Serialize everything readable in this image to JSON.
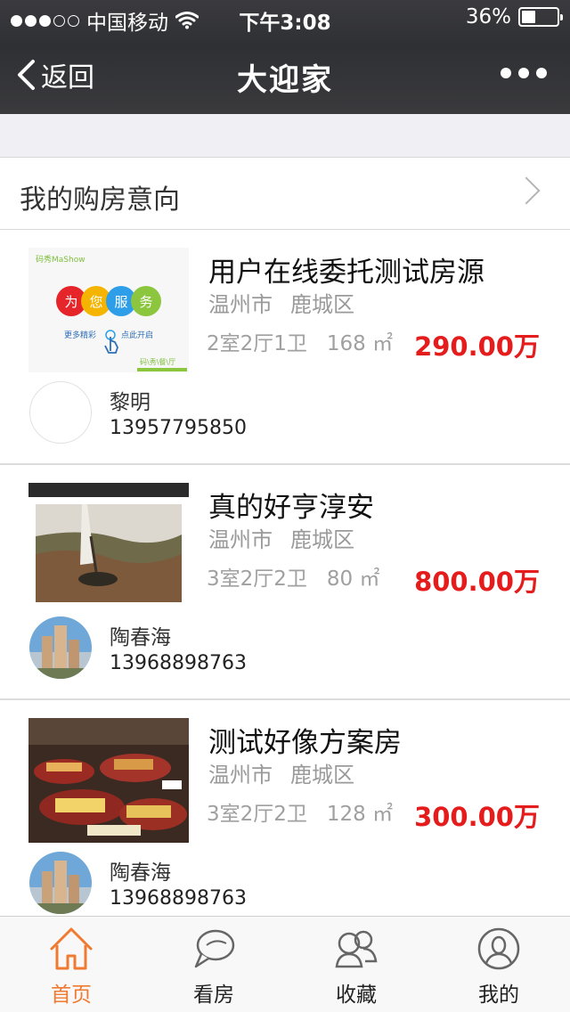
{
  "status_bar": {
    "carrier": "中国移动",
    "time": "下午3:08",
    "battery": "36%",
    "battery_level": 0.36
  },
  "nav": {
    "back_label": "返回",
    "title": "大迎家"
  },
  "intent": {
    "label": "我的购房意向"
  },
  "listings": [
    {
      "title": "用户在线委托测试房源",
      "city": "温州市",
      "district": "鹿城区",
      "rooms": "2室2厅1卫",
      "area": "168 ㎡",
      "price": "290.00万",
      "agent_name": "黎明",
      "agent_phone": "13957795850",
      "thumb_texts": {
        "brand": "码秀MaShow",
        "c1": "为",
        "c2": "您",
        "c3": "服",
        "c4": "务",
        "more": "更多精彩",
        "open": "点此开启",
        "foot": "码\\秀\\餐\\厅"
      }
    },
    {
      "title": "真的好亨淳安",
      "city": "温州市",
      "district": "鹿城区",
      "rooms": "3室2厅2卫",
      "area": "80 ㎡",
      "price": "800.00万",
      "agent_name": "陶春海",
      "agent_phone": "13968898763"
    },
    {
      "title": "测试好像方案房",
      "city": "温州市",
      "district": "鹿城区",
      "rooms": "3室2厅2卫",
      "area": "128 ㎡",
      "price": "300.00万",
      "agent_name": "陶春海",
      "agent_phone": "13968898763"
    }
  ],
  "tabs": [
    {
      "label": "首页",
      "icon": "home-icon",
      "active": true
    },
    {
      "label": "看房",
      "icon": "chat-bubble-icon",
      "active": false
    },
    {
      "label": "收藏",
      "icon": "favorites-icon",
      "active": false
    },
    {
      "label": "我的",
      "icon": "user-icon",
      "active": false
    }
  ],
  "colors": {
    "accent": "#f07a30",
    "price": "#e51c1c",
    "navbar": "#333336"
  }
}
